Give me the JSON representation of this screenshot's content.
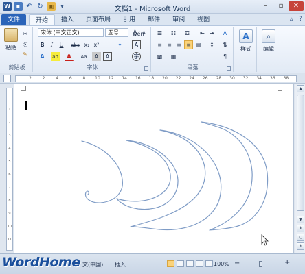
{
  "window": {
    "title": "文档1 - Microsoft Word",
    "min_glyph": "–",
    "max_glyph": "▫",
    "close_glyph": "✕"
  },
  "qat": {
    "logo": "W",
    "save": "▪",
    "undo": "↶",
    "redo": "↻",
    "open": "▣",
    "more": "▾"
  },
  "tabs": [
    {
      "label": "文件"
    },
    {
      "label": "开始"
    },
    {
      "label": "插入"
    },
    {
      "label": "页面布局"
    },
    {
      "label": "引用"
    },
    {
      "label": "邮件"
    },
    {
      "label": "审阅"
    },
    {
      "label": "视图"
    }
  ],
  "tab_extras": {
    "minimize": "▵",
    "help": "?"
  },
  "ribbon": {
    "clipboard": {
      "label": "剪贴板",
      "paste": "粘贴",
      "cut": "✂",
      "copy": "⎘",
      "painter": "✎"
    },
    "font": {
      "label": "字体",
      "name": "宋体 (中文正文)",
      "size": "五号",
      "grow": "A",
      "shrink": "A",
      "clear": "✦",
      "wen": "wén",
      "a_big": "A",
      "bold": "B",
      "italic": "I",
      "underline": "U",
      "strike": "abc",
      "sub": "x₂",
      "sup": "x²",
      "effects": "A",
      "highlight": "ab",
      "color": "A",
      "aa": "Aa",
      "shade": "A",
      "border": "A",
      "circle": "字"
    },
    "paragraph": {
      "label": "段落",
      "bullets": "☰",
      "numbering": "☷",
      "multilevel": "☲",
      "dec_indent": "⇤",
      "inc_indent": "⇥",
      "asian": "A",
      "sort": "⇅",
      "marks": "¶",
      "align_left": "≡",
      "align_center": "≡",
      "align_right": "≡",
      "justify": "≡",
      "distribute": "▤",
      "spacing": "↕",
      "shading": "▩",
      "borders": "▦"
    },
    "styles": {
      "label": "样式",
      "icon": "A"
    },
    "editing": {
      "label": "编辑",
      "icon": "⌕"
    }
  },
  "ruler": {
    "ticks": [
      "2",
      "2",
      "4",
      "6",
      "8",
      "10",
      "12",
      "14",
      "16",
      "18",
      "20",
      "22",
      "24",
      "26",
      "28",
      "30",
      "32",
      "34",
      "36",
      "38"
    ],
    "vticks": [
      "1",
      "2",
      "3",
      "4",
      "5",
      "6",
      "7",
      "8",
      "9",
      "10",
      "11"
    ]
  },
  "scrollbar": {
    "up": "▲",
    "down": "▼",
    "prev": "⇞",
    "select": "○",
    "next": "⇟"
  },
  "statusbar": {
    "language": "文(中国)",
    "mode": "插入",
    "zoom": "100%",
    "minus": "−",
    "plus": "+"
  },
  "watermark": "WordHome"
}
